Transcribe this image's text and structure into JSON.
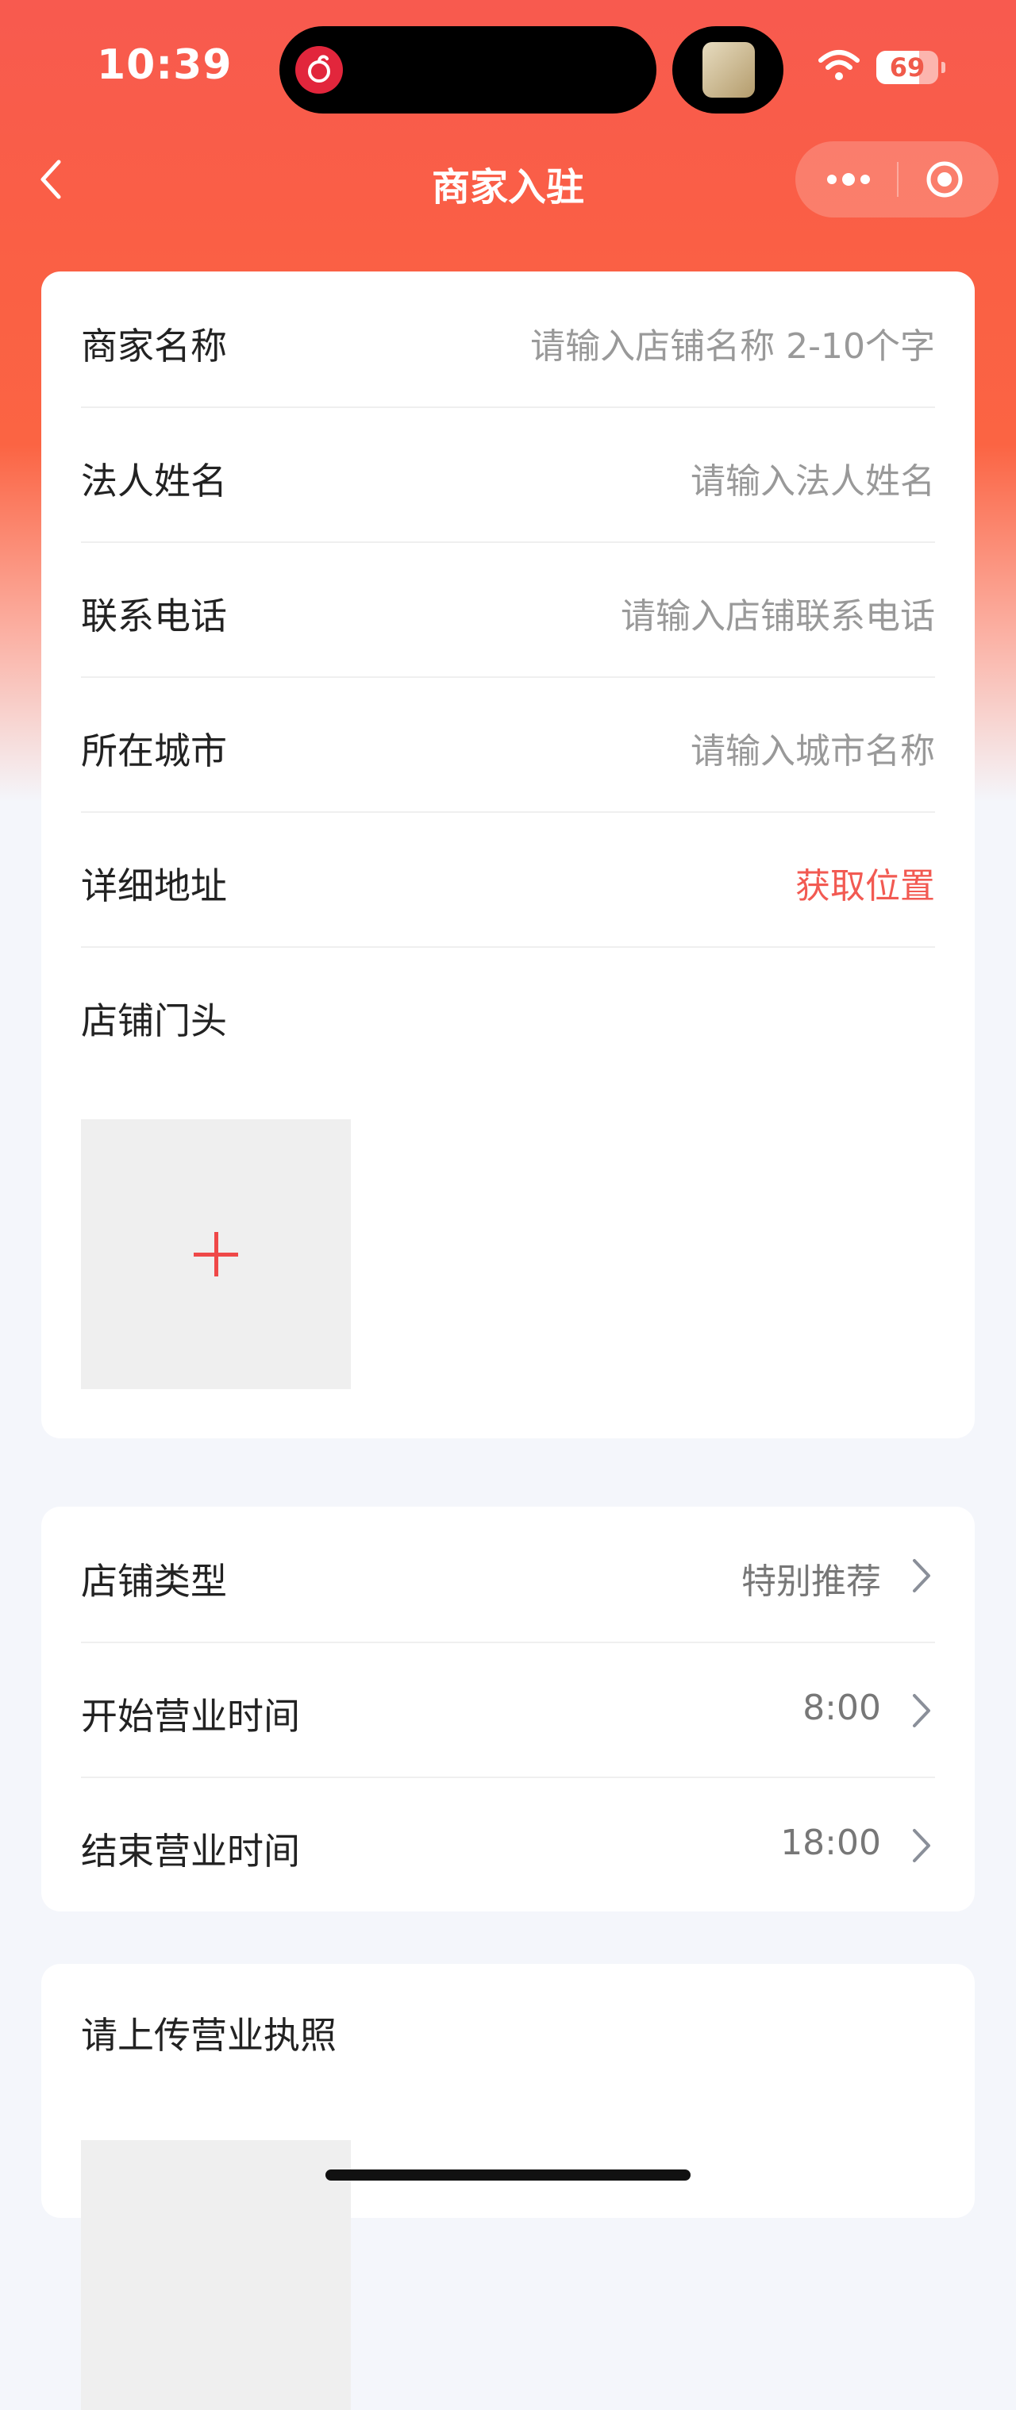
{
  "status_bar": {
    "time": "10:39",
    "battery": "69",
    "battery_level": 0.69,
    "left_island_icon": "music-app-icon",
    "right_island_icon": "album-art-icon",
    "wifi_icon": "wifi-icon"
  },
  "nav": {
    "title": "商家入驻",
    "back_icon": "back-arrow-icon",
    "more_icon": "more-dots-icon",
    "close_icon": "target-close-icon"
  },
  "form": {
    "merchant_name": {
      "label": "商家名称",
      "placeholder": "请输入店铺名称 2-10个字"
    },
    "legal_name": {
      "label": "法人姓名",
      "placeholder": "请输入法人姓名"
    },
    "phone": {
      "label": "联系电话",
      "placeholder": "请输入店铺联系电话"
    },
    "city": {
      "label": "所在城市",
      "placeholder": "请输入城市名称"
    },
    "address": {
      "label": "详细地址",
      "action": "获取位置"
    },
    "storefront": {
      "label": "店铺门头"
    }
  },
  "settings": {
    "shop_type": {
      "label": "店铺类型",
      "value": "特别推荐"
    },
    "open_time": {
      "label": "开始营业时间",
      "value": "8:00"
    },
    "close_time": {
      "label": "结束营业时间",
      "value": "18:00"
    }
  },
  "license": {
    "label": "请上传营业执照"
  },
  "colors": {
    "brand_red": "#f85a4f",
    "accent_red": "#f25a52",
    "plus_red": "#ef4848"
  }
}
